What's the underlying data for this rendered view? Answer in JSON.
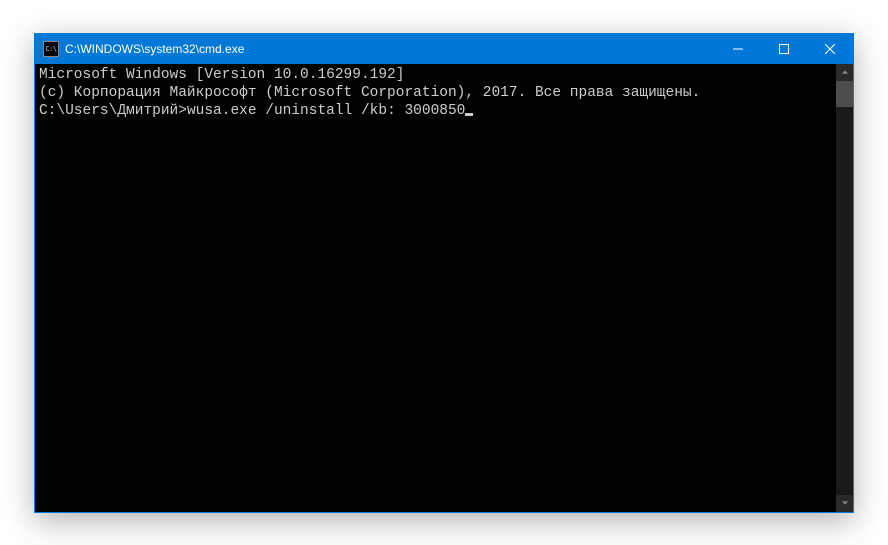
{
  "window": {
    "title": "C:\\WINDOWS\\system32\\cmd.exe",
    "icon_text": "C:\\"
  },
  "terminal": {
    "header_line1": "Microsoft Windows [Version 10.0.16299.192]",
    "header_line2": "(c) Корпорация Майкрософт (Microsoft Corporation), 2017. Все права защищены.",
    "blank": "",
    "prompt": "C:\\Users\\Дмитрий>",
    "command": "wusa.exe /uninstall /kb: 3000850"
  }
}
